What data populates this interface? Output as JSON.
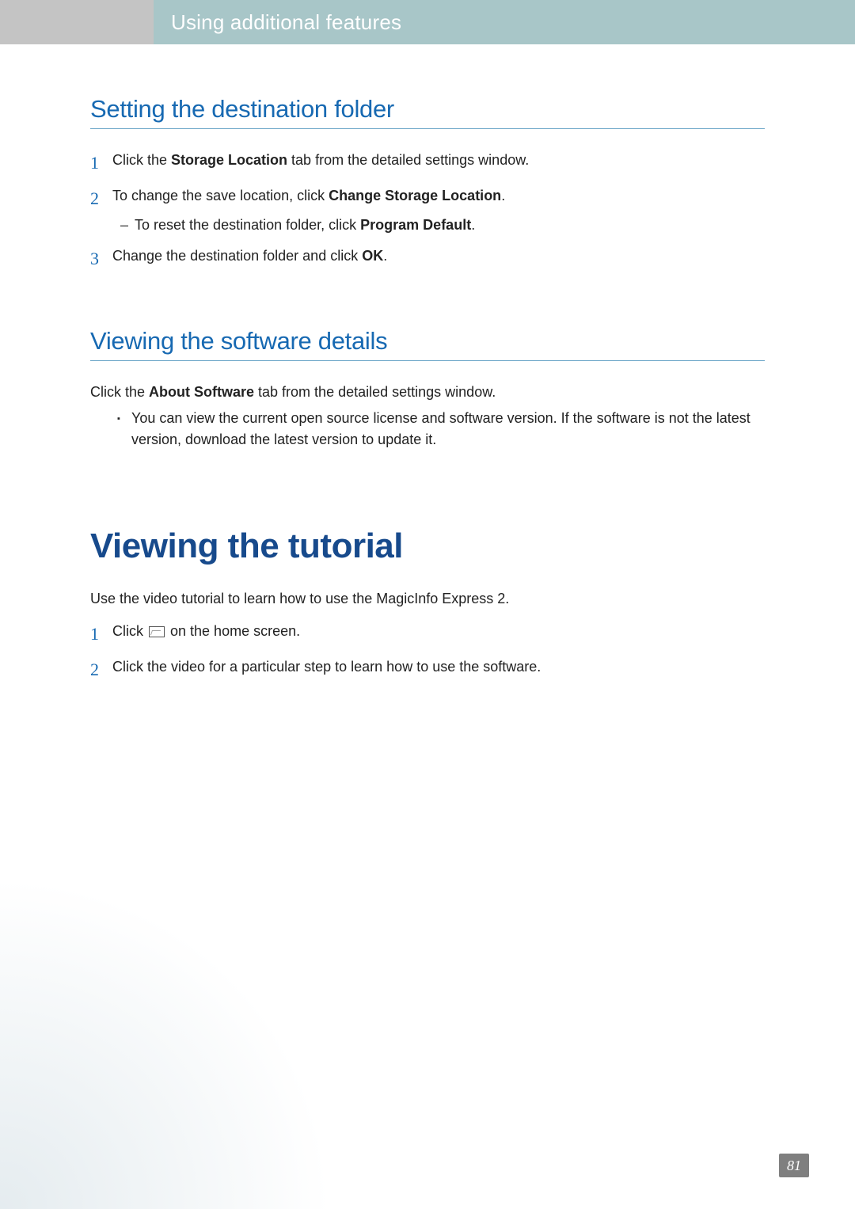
{
  "header": {
    "tab": "Using additional features"
  },
  "section1": {
    "title": "Setting the destination folder",
    "steps": [
      {
        "n": "1",
        "pre": "Click the ",
        "b1": "Storage Location",
        "post": " tab from the detailed settings window."
      },
      {
        "n": "2",
        "pre": "To change the save location, click ",
        "b1": "Change Storage Location",
        "post": ".",
        "sub_pre": "To reset the destination folder, click ",
        "sub_b": "Program Default",
        "sub_post": "."
      },
      {
        "n": "3",
        "pre": "Change the destination folder and click ",
        "b1": "OK",
        "post": "."
      }
    ]
  },
  "section2": {
    "title": "Viewing the software details",
    "intro_pre": "Click the ",
    "intro_b": "About Software",
    "intro_post": " tab from the detailed settings window.",
    "bullet": "You can view the current open source license and software version. If the software is not the latest version, download the latest version to update it."
  },
  "section3": {
    "title": "Viewing the tutorial",
    "intro": "Use the video tutorial to learn how to use the MagicInfo Express 2.",
    "steps": [
      {
        "n": "1",
        "pre": "Click ",
        "post": " on the home screen."
      },
      {
        "n": "2",
        "text": "Click the video for a particular step to learn how to use the software."
      }
    ]
  },
  "page_number": "81"
}
